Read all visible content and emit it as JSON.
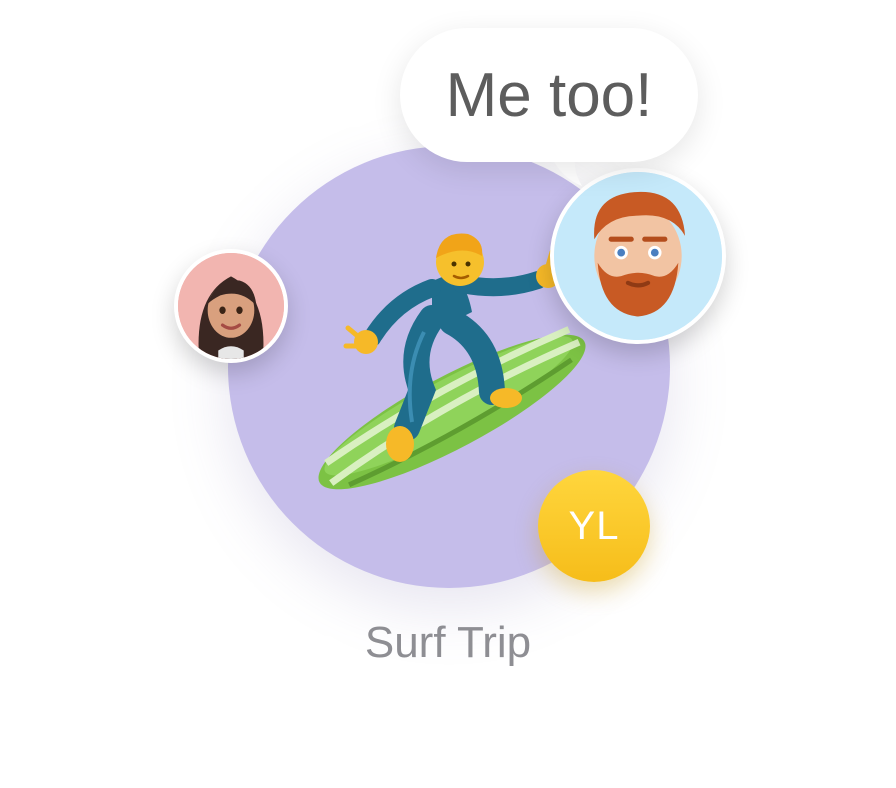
{
  "group": {
    "name": "Surf Trip",
    "avatar_icon": "surfer-emoji",
    "circle_color": "#c5bdea"
  },
  "message_bubble": {
    "text": "Me too!"
  },
  "participants": [
    {
      "type": "memoji",
      "icon": "woman-memoji",
      "background": "#f2b5b0"
    },
    {
      "type": "memoji",
      "icon": "man-red-beard-memoji",
      "background": "#c5e9fa"
    },
    {
      "type": "initials",
      "initials": "YL",
      "background": "#ffcc22"
    }
  ]
}
